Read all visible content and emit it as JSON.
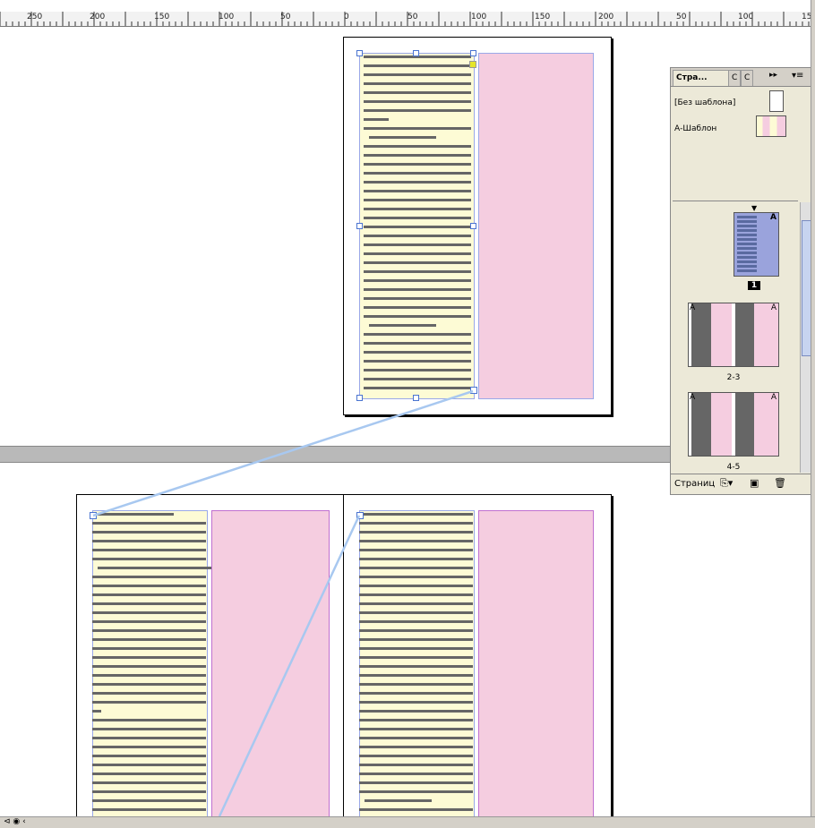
{
  "ruler": {
    "labels": [
      "250",
      "200",
      "150",
      "100",
      "50",
      "0",
      "50",
      "100",
      "150",
      "200",
      "50",
      "100",
      "15"
    ]
  },
  "panel": {
    "tabs": [
      "Стра...",
      "С",
      "С"
    ],
    "menu_icon": "panel-menu-icon",
    "masters": [
      {
        "label": "[Без шаблона]"
      },
      {
        "label": "А-Шаблон"
      }
    ],
    "pages": [
      {
        "label": "1",
        "master_letter": "A"
      },
      {
        "label": "2-3",
        "master_letter": "A"
      },
      {
        "label": "4-5",
        "master_letter": "A"
      }
    ],
    "footer_label": "Страниц"
  },
  "colors": {
    "text_frame": "#fdfbd5",
    "pink_frame": "#f5cde0",
    "link": "#a8c8f0",
    "selection": "#4a74d0"
  }
}
